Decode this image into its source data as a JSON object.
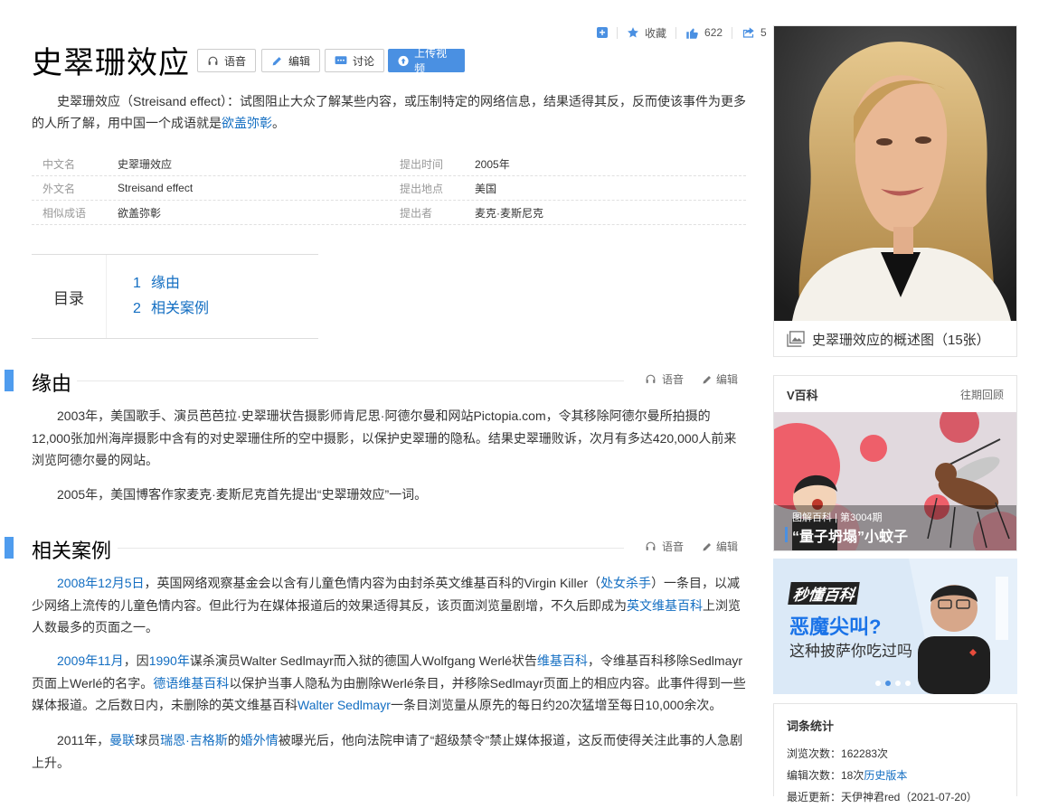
{
  "toolbar": {
    "add_icon": "plus-square-icon",
    "collect_label": "收藏",
    "like_count": "622",
    "share_count": "5"
  },
  "header": {
    "title": "史翠珊效应",
    "buttons": {
      "voice": "语音",
      "edit": "编辑",
      "discuss": "讨论",
      "upload_video": "上传视频"
    }
  },
  "summary": {
    "text": "史翠珊效应（Streisand effect）：试图阻止大众了解某些内容，或压制特定的网络信息，结果适得其反，反而使该事件为更多的人所了解，用中国一个成语就是",
    "link": "欲盖弥彰",
    "end": "。"
  },
  "basic_info": [
    {
      "k1": "中文名",
      "v1": "史翠珊效应",
      "k2": "提出时间",
      "v2": "2005年"
    },
    {
      "k1": "外文名",
      "v1": "Streisand effect",
      "k2": "提出地点",
      "v2": "美国"
    },
    {
      "k1": "相似成语",
      "v1": "欲盖弥彰",
      "k2": "提出者",
      "v2": "麦克·麦斯尼克"
    }
  ],
  "toc": {
    "label": "目录",
    "items": [
      {
        "num": "1",
        "text": "缘由"
      },
      {
        "num": "2",
        "text": "相关案例"
      }
    ]
  },
  "sections": {
    "tool_voice": "语音",
    "tool_edit": "编辑",
    "origin": {
      "title": "缘由",
      "p1": "2003年，美国歌手、演员芭芭拉·史翠珊状告摄影师肯尼思·阿德尔曼和网站Pictopia.com，令其移除阿德尔曼所拍摄的12,000张加州海岸摄影中含有的对史翠珊住所的空中摄影，以保护史翠珊的隐私。结果史翠珊败诉，次月有多达420,000人前来浏览阿德尔曼的网站。",
      "p2": "2005年，美国博客作家麦克·麦斯尼克首先提出“史翠珊效应”一词。"
    },
    "cases": {
      "title": "相关案例",
      "p1": {
        "l1": "2008年12月5日",
        "t1": "，英国网络观察基金会以含有儿童色情内容为由封杀英文维基百科的Virgin Killer（",
        "l2": "处女杀手",
        "t2": "）一条目，以减少网络上流传的儿童色情内容。但此行为在媒体报道后的效果适得其反，该页面浏览量剧增，不久后即成为",
        "l3": "英文维基百科",
        "t3": "上浏览人数最多的页面之一。"
      },
      "p2": {
        "l1": "2009年11月",
        "t1": "，因",
        "l2": "1990年",
        "t2": "谋杀演员Walter Sedlmayr而入狱的德国人Wolfgang Werlé状告",
        "l3": "维基百科",
        "t3": "，令维基百科移除Sedlmayr页面上Werlé的名字。",
        "l4": "德语维基百科",
        "t4": "以保护当事人隐私为由删除Werlé条目，并移除Sedlmayr页面上的相应内容。此事件得到一些媒体报道。之后数日内，未删除的英文维基百科",
        "l5": "Walter Sedlmayr",
        "t5": "一条目浏览量从原先的每日约20次猛增至每日10,000余次。"
      },
      "p3": {
        "t0": "2011年，",
        "l1": "曼联",
        "t1": "球员",
        "l2": "瑞恩·吉格斯",
        "t2": "的",
        "l3": "婚外情",
        "t3": "被曝光后，他向法院申请了“超级禁令”禁止媒体报道，这反而使得关注此事的人急剧上升。"
      }
    }
  },
  "sidebar": {
    "hero_caption": "史翠珊效应的概述图（15张）",
    "vbaike": {
      "title": "V百科",
      "more": "往期回顾",
      "tag1": "图解百科",
      "tag2": "第3004期",
      "headline": "“量子坍塌”小蚊子"
    },
    "banner": {
      "logo": "秒懂百科",
      "line1": "恶魔尖叫?",
      "line2": "这种披萨你吃过吗"
    },
    "stats": {
      "title": "词条统计",
      "browse_label": "浏览次数：",
      "browse_value": "162283次",
      "edit_label": "编辑次数：18次",
      "edit_link": "历史版本",
      "update_label": "最近更新：",
      "update_value": "天伊神君red（2021-07-20）"
    }
  }
}
